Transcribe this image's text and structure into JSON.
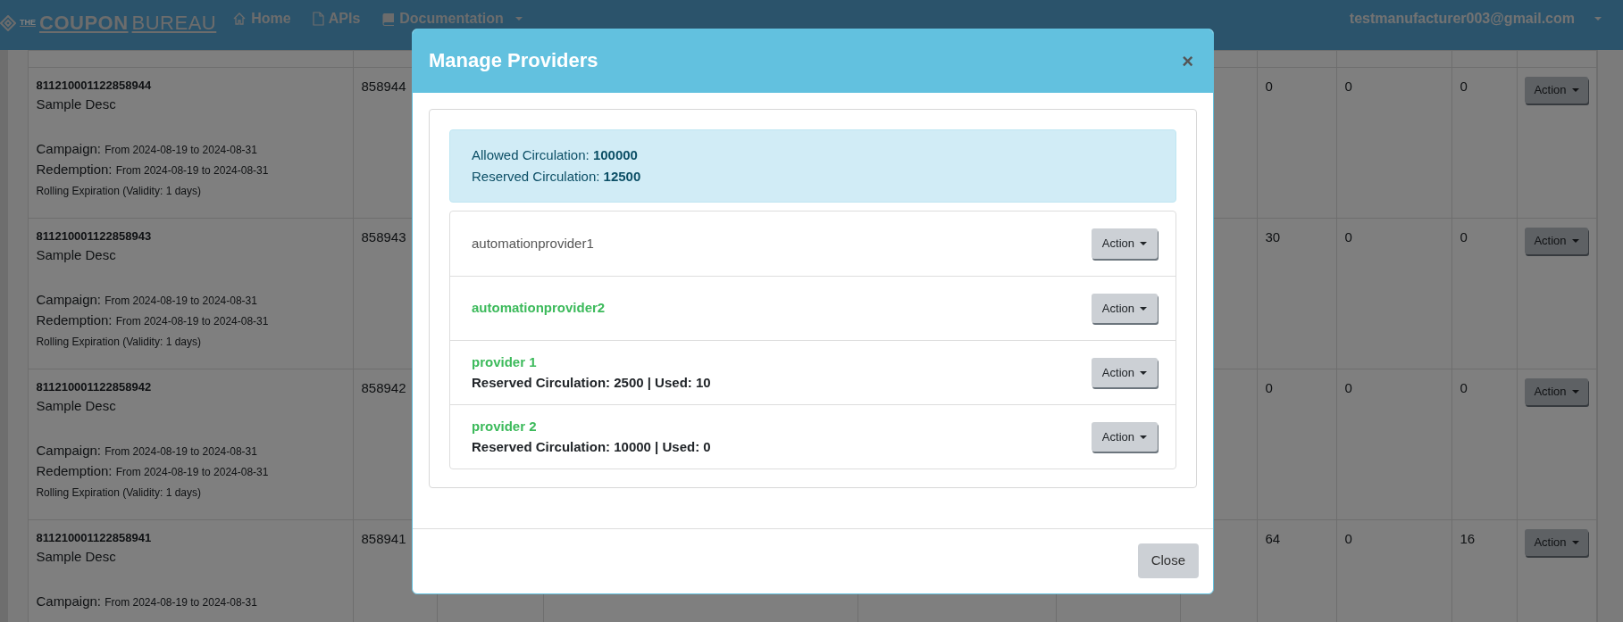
{
  "navbar": {
    "brand": {
      "small": "THE",
      "bold": "COUPON",
      "light": "BUREAU"
    },
    "links": [
      {
        "label": "Home",
        "dropdown": false
      },
      {
        "label": "APIs",
        "dropdown": false
      },
      {
        "label": "Documentation",
        "dropdown": true
      }
    ],
    "user": {
      "label": "testmanufacturer003@gmail.com",
      "dropdown": true
    }
  },
  "table": {
    "rows": [
      {
        "code": "811210001122858944",
        "description": "Sample Desc",
        "campaign_label": "Campaign:",
        "campaign_dates": "From 2024-08-19 to 2024-08-31",
        "redemption_label": "Redemption:",
        "redemption_dates": "From 2024-08-19 to 2024-08-31",
        "rolling": "Rolling Expiration (Validity: 1 days)",
        "column_2": "858944",
        "column_7": "0",
        "column_8": "0",
        "column_9": "0",
        "action": "Action"
      },
      {
        "code": "811210001122858943",
        "description": "Sample Desc",
        "campaign_label": "Campaign:",
        "campaign_dates": "From 2024-08-19 to 2024-08-31",
        "redemption_label": "Redemption:",
        "redemption_dates": "From 2024-08-19 to 2024-08-31",
        "rolling": "Rolling Expiration (Validity: 1 days)",
        "column_2": "858943",
        "column_7": "30",
        "column_8": "0",
        "column_9": "0",
        "action": "Action"
      },
      {
        "code": "811210001122858942",
        "description": "Sample Desc",
        "campaign_label": "Campaign:",
        "campaign_dates": "From 2024-08-19 to 2024-08-31",
        "redemption_label": "Redemption:",
        "redemption_dates": "From 2024-08-19 to 2024-08-31",
        "rolling": "Rolling Expiration (Validity: 1 days)",
        "column_2": "858942",
        "column_7": "0",
        "column_8": "0",
        "column_9": "0",
        "action": "Action"
      },
      {
        "code": "811210001122858941",
        "description": "Sample Desc",
        "campaign_label": "Campaign:",
        "campaign_dates": "From 2024-08-19 to 2024-08-31",
        "column_2": "858941",
        "column_7": "64",
        "column_8": "0",
        "column_9": "16",
        "action": "Action"
      }
    ]
  },
  "modal": {
    "title": "Manage Providers",
    "close": "×",
    "summary": [
      {
        "label": "Allowed Circulation:",
        "value": "100000"
      },
      {
        "label": "Reserved Circulation:",
        "value": "12500"
      }
    ],
    "providers": [
      {
        "name": "automationprovider1",
        "assigned": false,
        "action": "Action"
      },
      {
        "name": "automationprovider2",
        "assigned": true,
        "action": "Action"
      },
      {
        "name": "provider 1",
        "assigned": true,
        "detail": "Reserved Circulation: 2500 | Used: 10",
        "action": "Action"
      },
      {
        "name": "provider 2",
        "assigned": true,
        "detail": "Reserved Circulation: 10000 | Used: 0",
        "action": "Action"
      }
    ],
    "footer_button": "Close"
  }
}
